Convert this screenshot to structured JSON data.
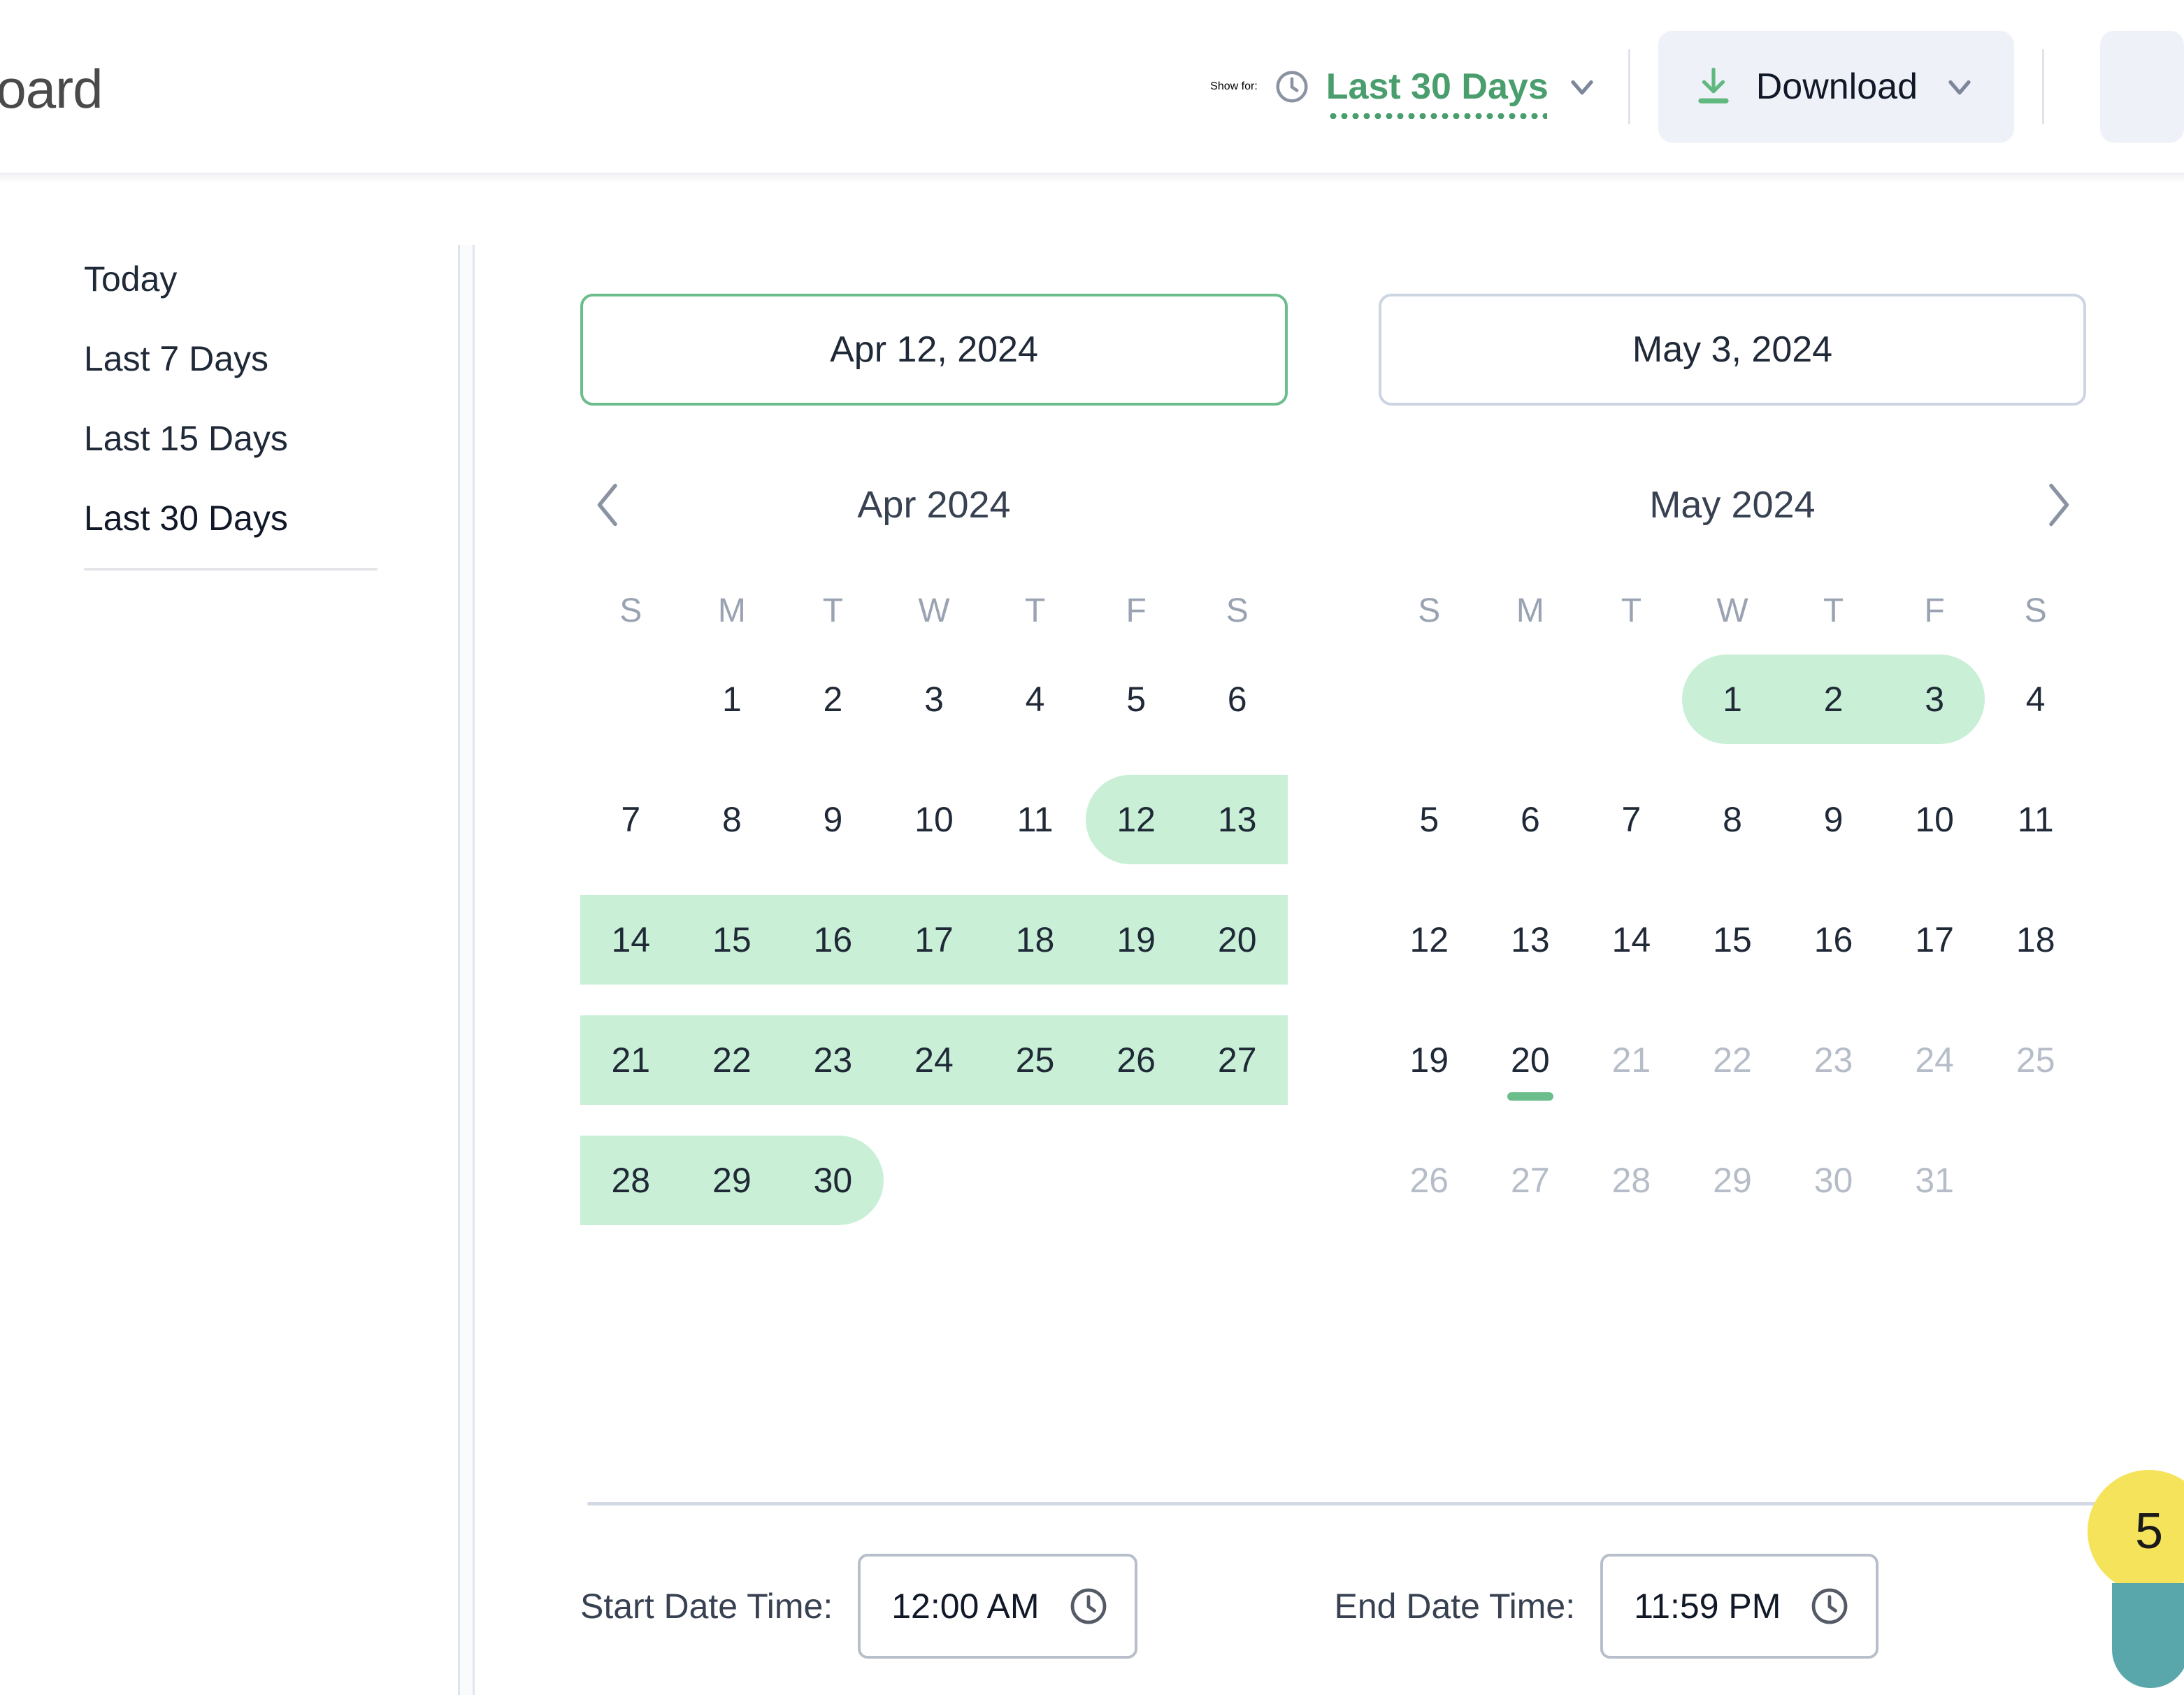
{
  "header": {
    "page_title": "board",
    "show_for_label": "Show for:",
    "show_for_value": "Last 30 Days",
    "download_label": "Download",
    "clock_icon": "clock-icon",
    "chevron_icon": "chevron-down-icon",
    "download_icon": "download-icon"
  },
  "presets": {
    "items": [
      {
        "label": "Today",
        "active": false
      },
      {
        "label": "Last 7 Days",
        "active": false
      },
      {
        "label": "Last 15 Days",
        "active": false
      },
      {
        "label": "Last 30 Days",
        "active": true
      }
    ]
  },
  "date_inputs": {
    "start": "Apr 12, 2024",
    "end": "May 3, 2024"
  },
  "calendars": [
    {
      "title": "Apr 2024",
      "prev_arrow": "chevron-left-icon",
      "next_arrow": null,
      "dow": [
        "S",
        "M",
        "T",
        "W",
        "T",
        "F",
        "S"
      ],
      "weeks": [
        [
          null,
          1,
          2,
          3,
          4,
          5,
          6
        ],
        [
          7,
          8,
          9,
          10,
          11,
          12,
          13
        ],
        [
          14,
          15,
          16,
          17,
          18,
          19,
          20
        ],
        [
          21,
          22,
          23,
          24,
          25,
          26,
          27
        ],
        [
          28,
          29,
          30,
          null,
          null,
          null,
          null
        ]
      ],
      "selected_range": {
        "start": 12,
        "end": 30
      },
      "muted_days": [],
      "today": null
    },
    {
      "title": "May 2024",
      "prev_arrow": null,
      "next_arrow": "chevron-right-icon",
      "dow": [
        "S",
        "M",
        "T",
        "W",
        "T",
        "F",
        "S"
      ],
      "weeks": [
        [
          null,
          null,
          null,
          1,
          2,
          3,
          4
        ],
        [
          5,
          6,
          7,
          8,
          9,
          10,
          11
        ],
        [
          12,
          13,
          14,
          15,
          16,
          17,
          18
        ],
        [
          19,
          20,
          21,
          22,
          23,
          24,
          25
        ],
        [
          26,
          27,
          28,
          29,
          30,
          31,
          null
        ]
      ],
      "selected_range": {
        "start": 1,
        "end": 3
      },
      "muted_days": [
        21,
        22,
        23,
        24,
        25,
        26,
        27,
        28,
        29,
        30,
        31
      ],
      "today": 20
    }
  ],
  "time_section": {
    "start_label": "Start Date Time:",
    "start_value": "12:00 AM",
    "end_label": "End Date Time:",
    "end_value": "11:59 PM",
    "clock_icon": "clock-icon"
  },
  "badge": {
    "count": "5"
  },
  "colors": {
    "accent_green": "#4a9e6d",
    "range_highlight": "#c9f0d6",
    "today_marker": "#6cbd8c",
    "selected_border": "#6cbd8c",
    "badge_yellow": "#f5e35c",
    "badge_teal": "#5aa7ab"
  }
}
